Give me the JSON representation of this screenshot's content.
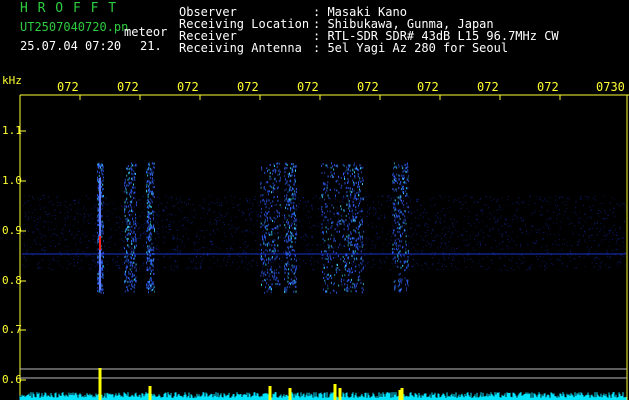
{
  "header": {
    "app_title": "H R O F F T",
    "filename": "UT2507040720.pn",
    "mode": "meteor",
    "datetime": "25.07.04 07:20",
    "count": "21.",
    "info_labels": [
      "Observer",
      "Receiving Location",
      "Receiver",
      "Receiving Antenna"
    ],
    "info_values": [
      ": Masaki Kano",
      ": Shibukawa, Gunma, Japan",
      ": RTL-SDR SDR# 43dB L15 96.7MHz CW",
      ": 5el Yagi Az 280 for Seoul"
    ]
  },
  "axis": {
    "unit": "kHz",
    "y_labels": [
      "1.1",
      "1.0",
      "0.9",
      "0.8",
      "0.7",
      "0.6"
    ],
    "x_labels": [
      "072",
      "072",
      "072",
      "072",
      "072",
      "072",
      "072",
      "072",
      "072",
      "0730"
    ]
  },
  "colors": {
    "title": "#2ecc40",
    "text": "#ffffff",
    "axis": "#ffff33",
    "signal": "#2040ff",
    "hot": "#ff2020",
    "spectrum": "#00e5ff"
  }
}
